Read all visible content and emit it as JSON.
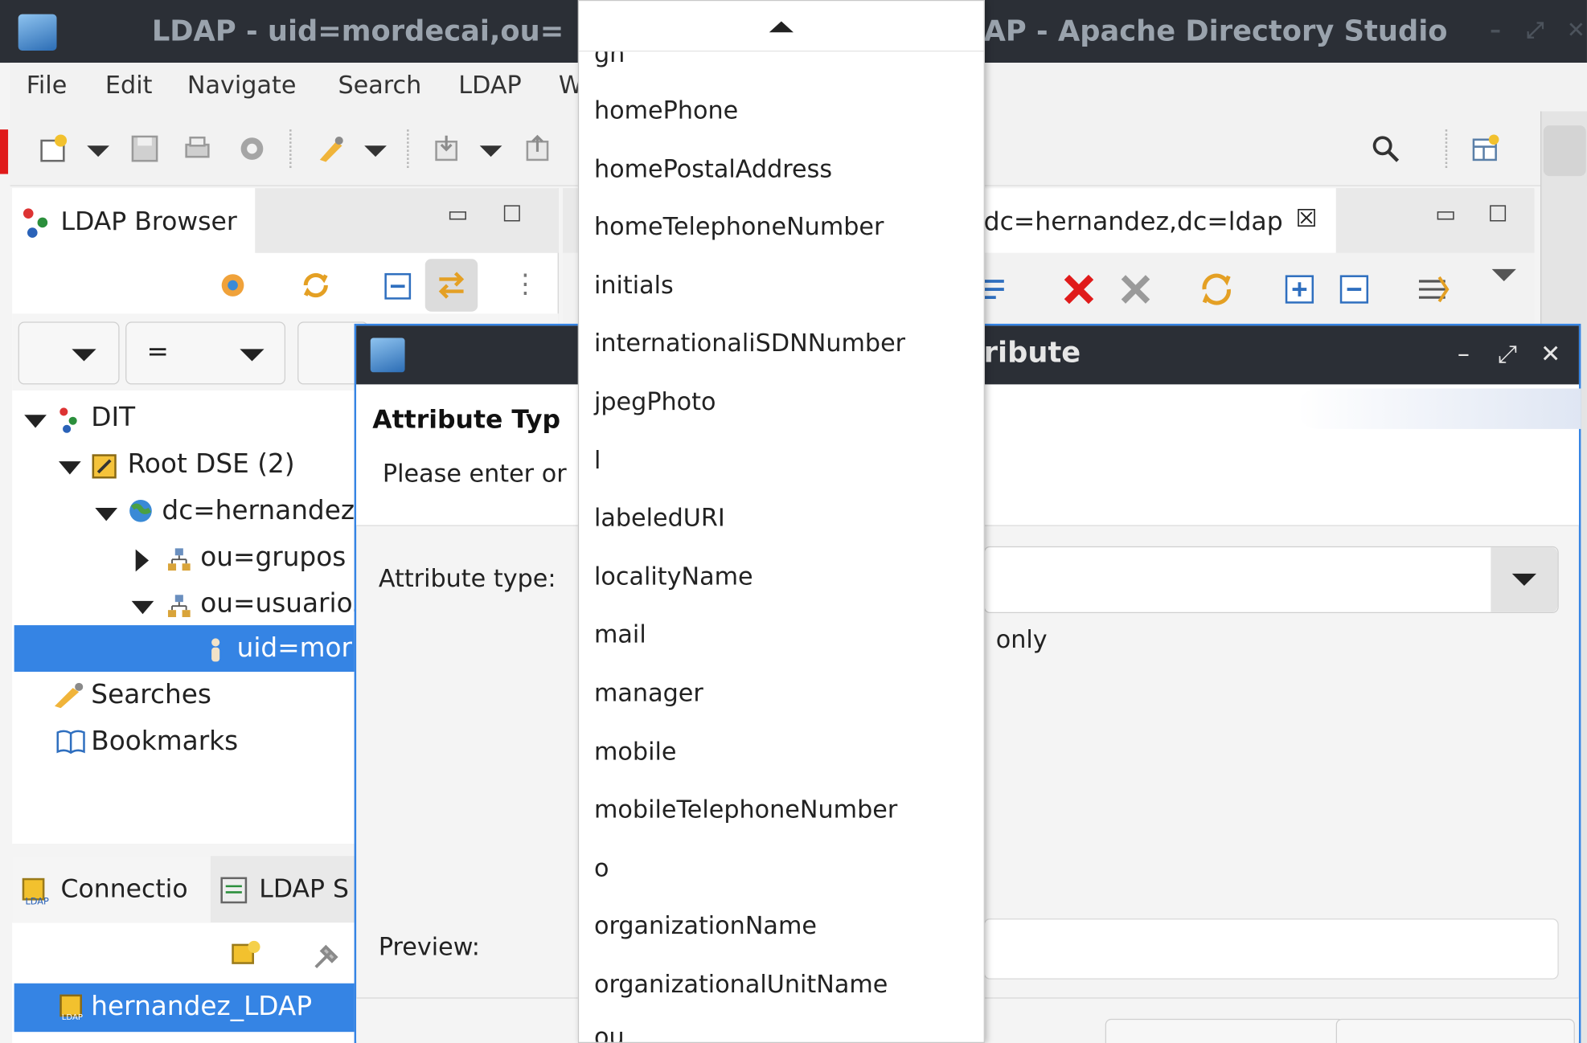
{
  "window": {
    "title_left": "LDAP - uid=mordecai,ou=",
    "title_right": "AP - Apache Directory Studio",
    "controls": [
      "–",
      "⤢",
      "✕"
    ]
  },
  "menu": [
    "File",
    "Edit",
    "Navigate",
    "Search",
    "LDAP",
    "W"
  ],
  "browser": {
    "tab_label": "LDAP Browser",
    "filter_operator": "=",
    "tree": [
      {
        "label": "DIT"
      },
      {
        "label": "Root DSE (2)"
      },
      {
        "label": "dc=hernandez"
      },
      {
        "label": "ou=grupos"
      },
      {
        "label": "ou=usuarios"
      },
      {
        "label": "uid=mor"
      },
      {
        "label": "Searches"
      },
      {
        "label": "Bookmarks"
      }
    ]
  },
  "connections": {
    "tab_label": "Connectio",
    "tab2_label": "LDAP S",
    "item": "hernandez_LDAP"
  },
  "editor": {
    "tab_label": "dc=hernandez,dc=ldap"
  },
  "dialog": {
    "title": "ribute",
    "header_title": "Attribute Typ",
    "header_desc": "Please enter or",
    "attribute_type_label": "Attribute type:",
    "only_label": "only",
    "preview_label": "Preview:"
  },
  "popup": {
    "partial_top": "gn",
    "items": [
      "homePhone",
      "homePostalAddress",
      "homeTelephoneNumber",
      "initials",
      "internationaliSDNNumber",
      "jpegPhoto",
      "l",
      "labeledURI",
      "localityName",
      "mail",
      "manager",
      "mobile",
      "mobileTelephoneNumber",
      "o",
      "organizationName",
      "organizationalUnitName"
    ],
    "partial_bottom": "ou"
  },
  "colors": {
    "selection": "#3584e4",
    "titlebar": "#2b2f36",
    "delete_red": "#e01b1b"
  }
}
